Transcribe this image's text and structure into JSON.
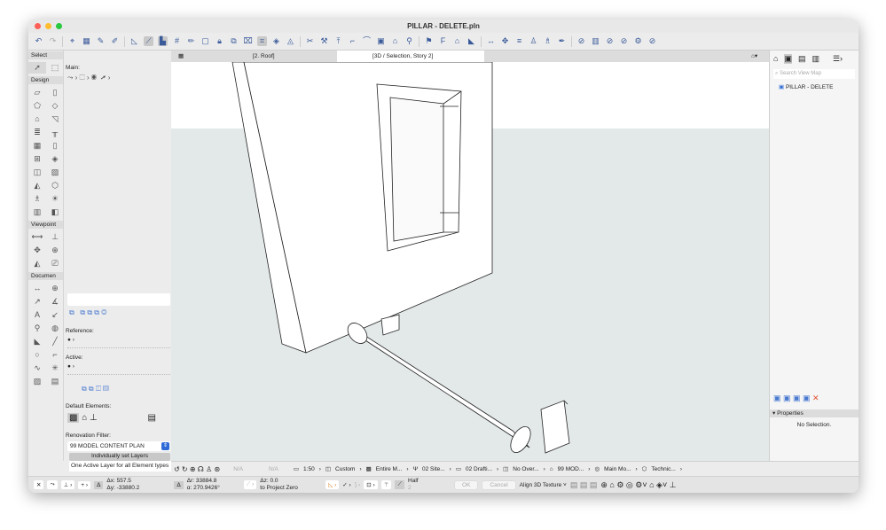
{
  "window": {
    "title": "PILLAR - DELETE.pln"
  },
  "tabs": [
    {
      "label": "[2. Roof]"
    },
    {
      "label": "[3D / Selection, Story 2]"
    }
  ],
  "toolbox": {
    "sections": [
      "Select",
      "Design",
      "Viewpoint",
      "Documen"
    ]
  },
  "info": {
    "main_label": "Main:",
    "reference_label": "Reference:",
    "active_label": "Active:",
    "default_elements_label": "Default Elements:",
    "renovation_filter_label": "Renovation Filter:",
    "renovation_filter_value": "99 MODEL CONTENT PLAN",
    "layers_button": "Individually set Layers",
    "layers_option": "One Active Layer for all Element types"
  },
  "navigator": {
    "search_placeholder": "Search View Map",
    "root_item": "PILLAR - DELETE",
    "properties_label": "Properties",
    "properties_value": "No Selection."
  },
  "view_bar": {
    "na1": "N/A",
    "na2": "N/A",
    "scale": "1:50",
    "custom": "Custom",
    "model": "Entire M...",
    "site": "02 Site...",
    "drafting": "02 Drafti...",
    "override": "No Over...",
    "mod": "99 MOD...",
    "main": "Main Mo...",
    "technic": "Technic..."
  },
  "coords": {
    "dx": "557.5",
    "dy": "-33880.2",
    "dr": "33884.8",
    "angle": "270.9426°",
    "dz": "0.0",
    "reference": "to Project Zero",
    "half": "Half",
    "half_value": "2"
  },
  "actions": {
    "ok": "OK",
    "cancel": "Cancel",
    "align": "Align 3D Texture"
  },
  "colors": {
    "accent": "#2f6bd6",
    "viewport_bg": "#e3e8e9"
  }
}
